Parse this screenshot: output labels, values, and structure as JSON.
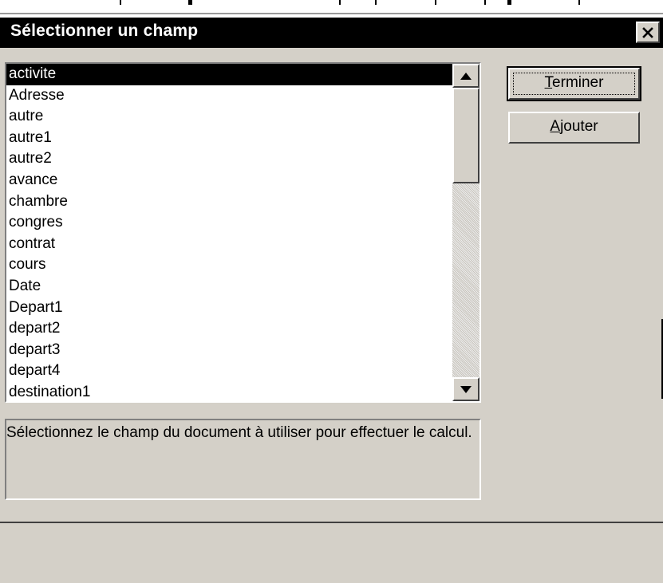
{
  "dialog": {
    "title": "Sélectionner un champ",
    "close_label": "×"
  },
  "fields_list": {
    "selected_index": 0,
    "items": [
      "activite",
      "Adresse",
      "autre",
      "autre1",
      "autre2",
      "avance",
      "chambre",
      "congres",
      "contrat",
      "cours",
      "Date",
      "Depart1",
      "depart2",
      "depart3",
      "depart4",
      "destination1"
    ]
  },
  "description": "Sélectionnez le champ du document à utiliser pour effectuer le calcul.",
  "buttons": {
    "finish": {
      "mnemonic": "T",
      "rest": "erminer"
    },
    "add": {
      "mnemonic": "A",
      "rest": "jouter"
    }
  },
  "icons": {
    "close": "close-icon",
    "scroll_up": "triangle-up-icon",
    "scroll_down": "triangle-down-icon"
  },
  "colors": {
    "face": "#d4d0c8",
    "title_bar": "#000000",
    "selection": "#000000",
    "list_background": "#ffffff"
  }
}
